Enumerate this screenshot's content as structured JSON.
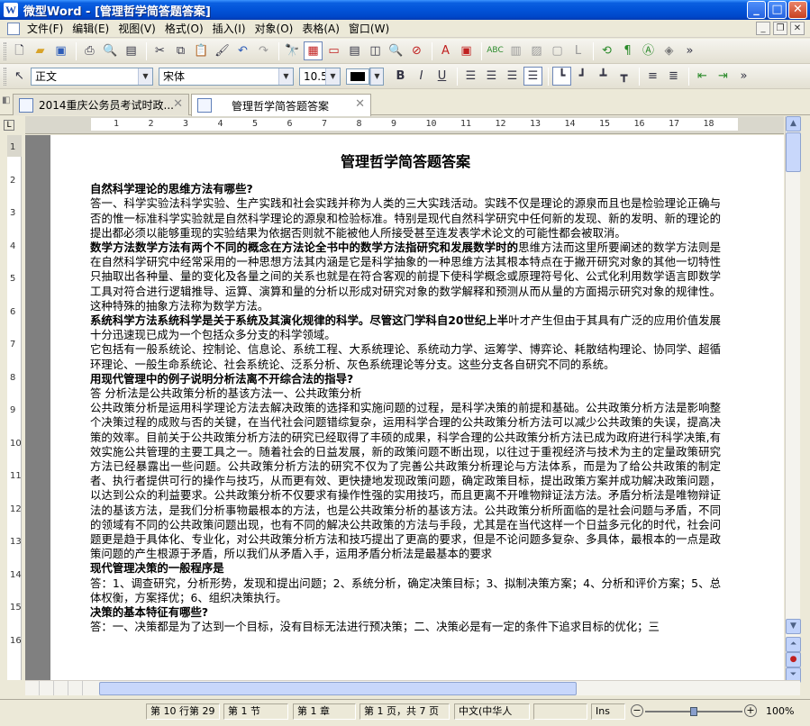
{
  "window": {
    "title": "微型Word - [管理哲学简答题答案]",
    "app_icon": "W",
    "buttons": [
      "_",
      "□",
      "✕"
    ]
  },
  "menu": {
    "items": [
      "文件(F)",
      "编辑(E)",
      "视图(V)",
      "格式(O)",
      "插入(I)",
      "对象(O)",
      "表格(A)",
      "窗口(W)"
    ]
  },
  "format_toolbar": {
    "style": "正文",
    "font": "宋体",
    "size": "10.5",
    "font_color": "#000000"
  },
  "tabs": [
    {
      "label": "2014重庆公务员考试时政..."
    },
    {
      "label": "管理哲学简答题答案"
    }
  ],
  "ruler": {
    "h_labels": [
      "1",
      "2",
      "3",
      "4",
      "5",
      "6",
      "7",
      "8",
      "9",
      "10",
      "11",
      "12",
      "13",
      "14",
      "15",
      "16",
      "17",
      "18"
    ],
    "v_labels": [
      "1",
      "2",
      "3",
      "4",
      "5",
      "6",
      "7",
      "8",
      "9",
      "10",
      "11",
      "12",
      "13",
      "14",
      "15",
      "16"
    ]
  },
  "document": {
    "title": "管理哲学简答题答案",
    "blocks": [
      {
        "q": "自然科学理论的思维方法有哪些?",
        "text": ""
      },
      {
        "q": "",
        "text": "答一、科学实验法科学实验、生产实践和社会实践并称为人类的三大实践活动。实践不仅是理论的源泉而且也是检验理论正确与否的惟一标准科学实验就是自然科学理论的源泉和检验标准。特别是现代自然科学研究中任何新的发现、新的发明、新的理论的提出都必须以能够重现的实验结果为依据否则就不能被他人所接受甚至连发表学术论文的可能性都会被取消。"
      },
      {
        "q": "数学方法数学方法有两个不同的概念在方法论全书中的数学方法指研究和发展数学时的",
        "text": "思维方法而这里所要阐述的数学方法则是在自然科学研究中经常采用的一种思想方法其内涵是它是科学抽象的一种思维方法其根本特点在于撇开研究对象的其他一切特性只抽取出各种量、量的变化及各量之间的关系也就是在符合客观的前提下使科学概念或原理符号化、公式化利用数学语言即数学工具对符合进行逻辑推导、运算、演算和量的分析以形成对研究对象的数学解释和预测从而从量的方面揭示研究对象的规律性。这种特殊的抽象方法称为数学方法。"
      },
      {
        "q": "系统科学方法系统科学是关于系统及其演化规律的科学。尽管这门学科自20世纪上半",
        "text": "叶才产生但由于其具有广泛的应用价值发展十分迅速现已成为一个包括众多分支的科学领域。"
      },
      {
        "q": "",
        "text": "它包括有一般系统论、控制论、信息论、系统工程、大系统理论、系统动力学、运筹学、博弈论、耗散结构理论、协同学、超循环理论、一般生命系统论、社会系统论、泛系分析、灰色系统理论等分支。这些分支各自研究不同的系统。"
      },
      {
        "q": "用现代管理中的例子说明分析法离不开综合法的指导?",
        "text": ""
      },
      {
        "q": "",
        "text": "答 分析法是公共政策分析的基该方法一、公共政策分析"
      },
      {
        "q": "",
        "text": "公共政策分析是运用科学理论方法去解决政策的选择和实施问题的过程，是科学决策的前提和基础。公共政策分析方法是影响整个决策过程的成败与否的关键，在当代社会问题错综复杂，运用科学合理的公共政策分析方法可以减少公共政策的失误，提高决策的效率。目前关于公共政策分析方法的研究已经取得了丰硕的成果，科学合理的公共政策分析方法已成为政府进行科学决策,有效实施公共管理的主要工具之一。随着社会的日益发展，新的政策问题不断出现，以往过于重视经济与技术为主的定量政策研究方法已经暴露出一些问题。公共政策分析方法的研究不仅为了完善公共政策分析理论与方法体系，而是为了给公共政策的制定者、执行者提供可行的操作与技巧，从而更有效、更快捷地发现政策问题，确定政策目标，提出政策方案并成功解决政策问题，以达到公众的利益要求。公共政策分析不仅要求有操作性强的实用技巧，而且更离不开唯物辩证法方法。矛盾分析法是唯物辩证法的基该方法，是我们分析事物最根本的方法，也是公共政策分析的基该方法。公共政策分析所面临的是社会问题与矛盾，不同的领域有不同的公共政策问题出现，也有不同的解决公共政策的方法与手段，尤其是在当代这样一个日益多元化的时代，社会问题更是趋于具体化、专业化，对公共政策分析方法和技巧提出了更高的要求，但是不论问题多复杂、多具体，最根本的一点是政策问题的产生根源于矛盾，所以我们从矛盾入手，运用矛盾分析法是最基本的要求"
      },
      {
        "q": "现代管理决策的一般程序是",
        "text": ""
      },
      {
        "q": "",
        "text": "答：1、调查研究，分析形势，发现和提出问题；2、系统分析，确定决策目标；3、拟制决策方案；4、分析和评价方案；5、总体权衡，方案择优；6、组织决策执行。"
      },
      {
        "q": "决策的基本特征有哪些?",
        "text": ""
      },
      {
        "q": "",
        "text": "答：一、决策都是为了达到一个目标，没有目标无法进行预决策；二、决策必是有一定的条件下追求目标的优化；三"
      }
    ]
  },
  "status": {
    "line_col": "第 10 行第 29",
    "section": "第 1 节",
    "chapter": "第 1 章",
    "pages": "第 1 页，共 7 页",
    "lang": "中文(中华人",
    "mode": "Ins",
    "zoom": "100%"
  }
}
